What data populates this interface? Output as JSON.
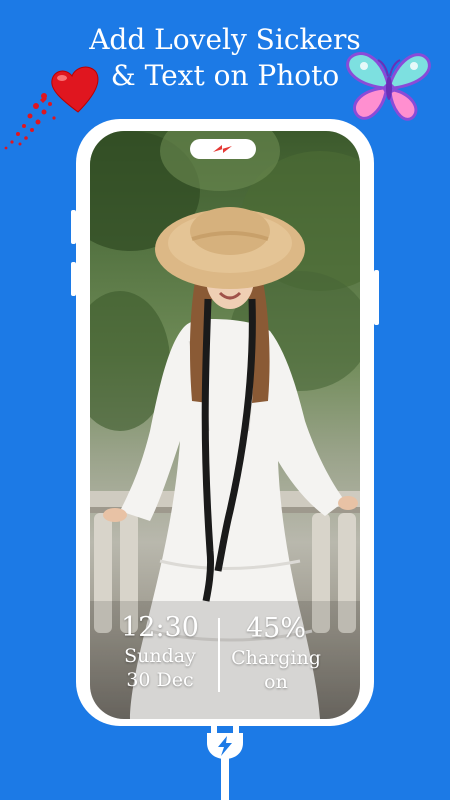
{
  "promo": {
    "headline_line1": "Add Lovely Sickers",
    "headline_line2": "& Text on Photo"
  },
  "lockscreen": {
    "time": "12:30",
    "day": "Sunday",
    "date": "30 Dec",
    "battery_percent": "45%",
    "charging_status": "Charging on"
  },
  "colors": {
    "background": "#1c7ae6",
    "phone_frame": "#ffffff",
    "heart": "#e0161f",
    "bolt": "#e53935"
  },
  "icons": {
    "heart_sticker": "hearts-icon",
    "butterfly_sticker": "butterfly-icon",
    "notch_indicator": "lightning-bolt-icon",
    "charger": "charger-plug-icon"
  }
}
